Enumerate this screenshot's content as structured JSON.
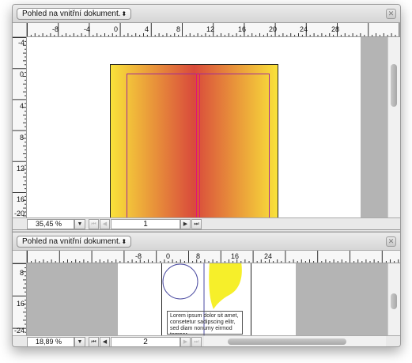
{
  "top_view": {
    "view_menu": "Pohled na vnitřní dokument.",
    "zoom": "35,45 %",
    "page_number": "1",
    "h_ruler_labels": [
      "-8",
      "-4",
      "0",
      "4",
      "8",
      "12",
      "16",
      "20",
      "24",
      "28"
    ],
    "v_ruler_labels": [
      "-4",
      "0",
      "4",
      "8",
      "12",
      "16",
      "-20"
    ]
  },
  "bottom_view": {
    "view_menu": "Pohled na vnitřní dokument.",
    "zoom": "18,89 %",
    "page_number": "2",
    "h_ruler_labels": [
      "-8",
      "0",
      "8",
      "16",
      "24"
    ],
    "v_ruler_labels": [
      "8",
      "16",
      "-24"
    ],
    "text_frame": "Lorem ipsum dolor sit amet, consetetur sadipscing elitr, sed diam nonumy eirmod tempor"
  },
  "icons": {
    "popup_arrows": "⬍",
    "close": "✕",
    "zoom_dropdown": "▼",
    "first_page": "⏮",
    "prev_page": "◀",
    "next_page": "▶",
    "last_page": "⏭"
  },
  "colors": {
    "gradient_edge": "#f9e23a",
    "gradient_center": "#d94a3b",
    "margin_guide": "#a02a9a",
    "spine_guide": "#e0147a",
    "yellow_shape": "#f6ef2a",
    "circle_stroke": "#4a4aa0"
  }
}
